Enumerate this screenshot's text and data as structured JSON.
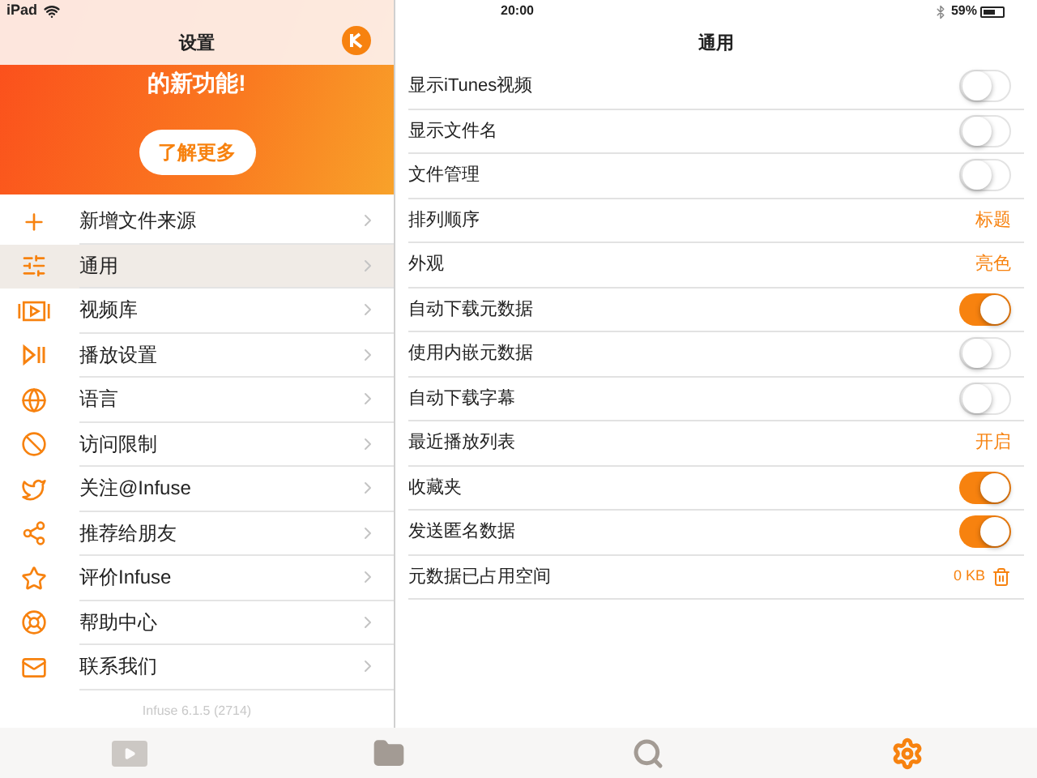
{
  "status_bar": {
    "device": "iPad",
    "time": "20:00",
    "battery": "59%"
  },
  "sidebar": {
    "title": "设置",
    "banner": {
      "text": "的新功能!",
      "button": "了解更多"
    },
    "items": [
      {
        "label": "新增文件来源",
        "selected": false
      },
      {
        "label": "通用",
        "selected": true
      },
      {
        "label": "视频库",
        "selected": false
      },
      {
        "label": "播放设置",
        "selected": false
      },
      {
        "label": "语言",
        "selected": false
      },
      {
        "label": "访问限制",
        "selected": false
      },
      {
        "label": "关注@Infuse",
        "selected": false
      },
      {
        "label": "推荐给朋友",
        "selected": false
      },
      {
        "label": "评价Infuse",
        "selected": false
      },
      {
        "label": "帮助中心",
        "selected": false
      },
      {
        "label": "联系我们",
        "selected": false
      }
    ],
    "version": "Infuse 6.1.5 (2714)"
  },
  "detail": {
    "title": "通用",
    "rows": [
      {
        "kind": "toggle",
        "label": "显示iTunes视频",
        "on": false
      },
      {
        "kind": "toggle",
        "label": "显示文件名",
        "on": false
      },
      {
        "kind": "toggle",
        "label": "文件管理",
        "on": false
      },
      {
        "kind": "value",
        "label": "排列顺序",
        "value": "标题"
      },
      {
        "kind": "value",
        "label": "外观",
        "value": "亮色"
      },
      {
        "kind": "toggle",
        "label": "自动下载元数据",
        "on": true
      },
      {
        "kind": "toggle",
        "label": "使用内嵌元数据",
        "on": false
      },
      {
        "kind": "toggle",
        "label": "自动下载字幕",
        "on": false
      },
      {
        "kind": "value",
        "label": "最近播放列表",
        "value": "开启"
      },
      {
        "kind": "toggle",
        "label": "收藏夹",
        "on": true
      },
      {
        "kind": "toggle",
        "label": "发送匿名数据",
        "on": true
      },
      {
        "kind": "storage",
        "label": "元数据已占用空间",
        "value": "0 KB"
      }
    ]
  },
  "tab_bar": [
    {
      "selected": false
    },
    {
      "selected": false
    },
    {
      "selected": false
    },
    {
      "selected": true
    }
  ]
}
